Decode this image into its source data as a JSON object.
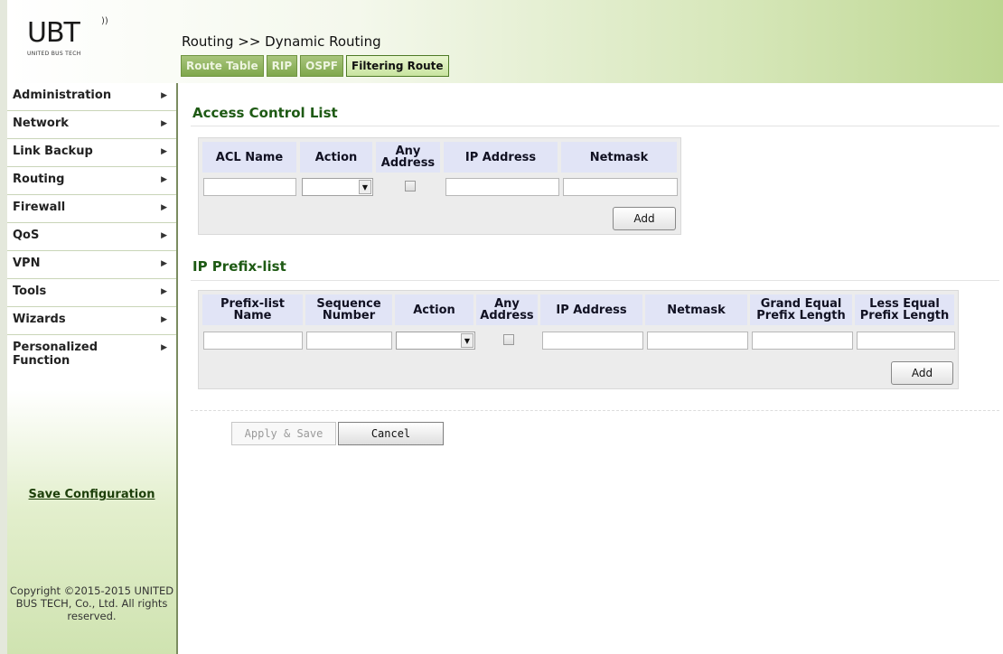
{
  "logo": {
    "mark": "UBT",
    "subtitle": "UNITED BUS TECH"
  },
  "header": {
    "breadcrumb": "Routing >> Dynamic Routing",
    "tabs": [
      {
        "label": "Route Table",
        "active": false
      },
      {
        "label": "RIP",
        "active": false
      },
      {
        "label": "OSPF",
        "active": false
      },
      {
        "label": "Filtering Route",
        "active": true
      }
    ]
  },
  "sidebar": {
    "items": [
      {
        "label": "Administration"
      },
      {
        "label": "Network"
      },
      {
        "label": "Link Backup"
      },
      {
        "label": "Routing"
      },
      {
        "label": "Firewall"
      },
      {
        "label": "QoS"
      },
      {
        "label": "VPN"
      },
      {
        "label": "Tools"
      },
      {
        "label": "Wizards"
      },
      {
        "label": "Personalized Function"
      }
    ],
    "save_link": "Save Configuration",
    "copyright": "Copyright ©2015-2015 UNITED BUS TECH, Co., Ltd. All rights reserved."
  },
  "acl": {
    "title": "Access Control List",
    "headers": [
      "ACL Name",
      "Action",
      "Any Address",
      "IP Address",
      "Netmask"
    ],
    "add_label": "Add"
  },
  "prefix": {
    "title": "IP Prefix-list",
    "headers": [
      "Prefix-list Name",
      "Sequence Number",
      "Action",
      "Any Address",
      "IP Address",
      "Netmask",
      "Grand Equal Prefix Length",
      "Less Equal Prefix Length"
    ],
    "add_label": "Add"
  },
  "actions": {
    "apply_label": "Apply & Save",
    "cancel_label": "Cancel"
  },
  "colors": {
    "section_title": "#1e5a14",
    "header_accent": "#bcd690",
    "table_header": "#e1e4f6"
  }
}
